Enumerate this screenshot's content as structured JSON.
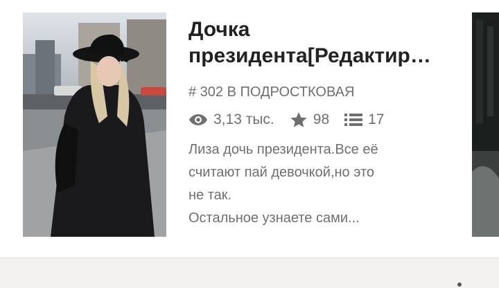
{
  "story": {
    "title_line1": "Дочка",
    "title_line2": "президента[Редактир…",
    "ranking": "# 302 В ПОДРОСТКОВАЯ",
    "stats": {
      "reads": "3,13 тыс.",
      "votes": "98",
      "parts": "17"
    },
    "description": [
      "Лиза дочь президента.Все её",
      "считают пай девочкой,но это",
      "не так.",
      "Остальное узнаете сами..."
    ]
  },
  "icons": {
    "reads": "eye-icon",
    "votes": "star-icon",
    "parts": "list-icon",
    "more": "dots-icon"
  },
  "colors": {
    "title": "#222222",
    "meta": "#6f6f6f",
    "footer_bg": "#f3f2f0"
  }
}
